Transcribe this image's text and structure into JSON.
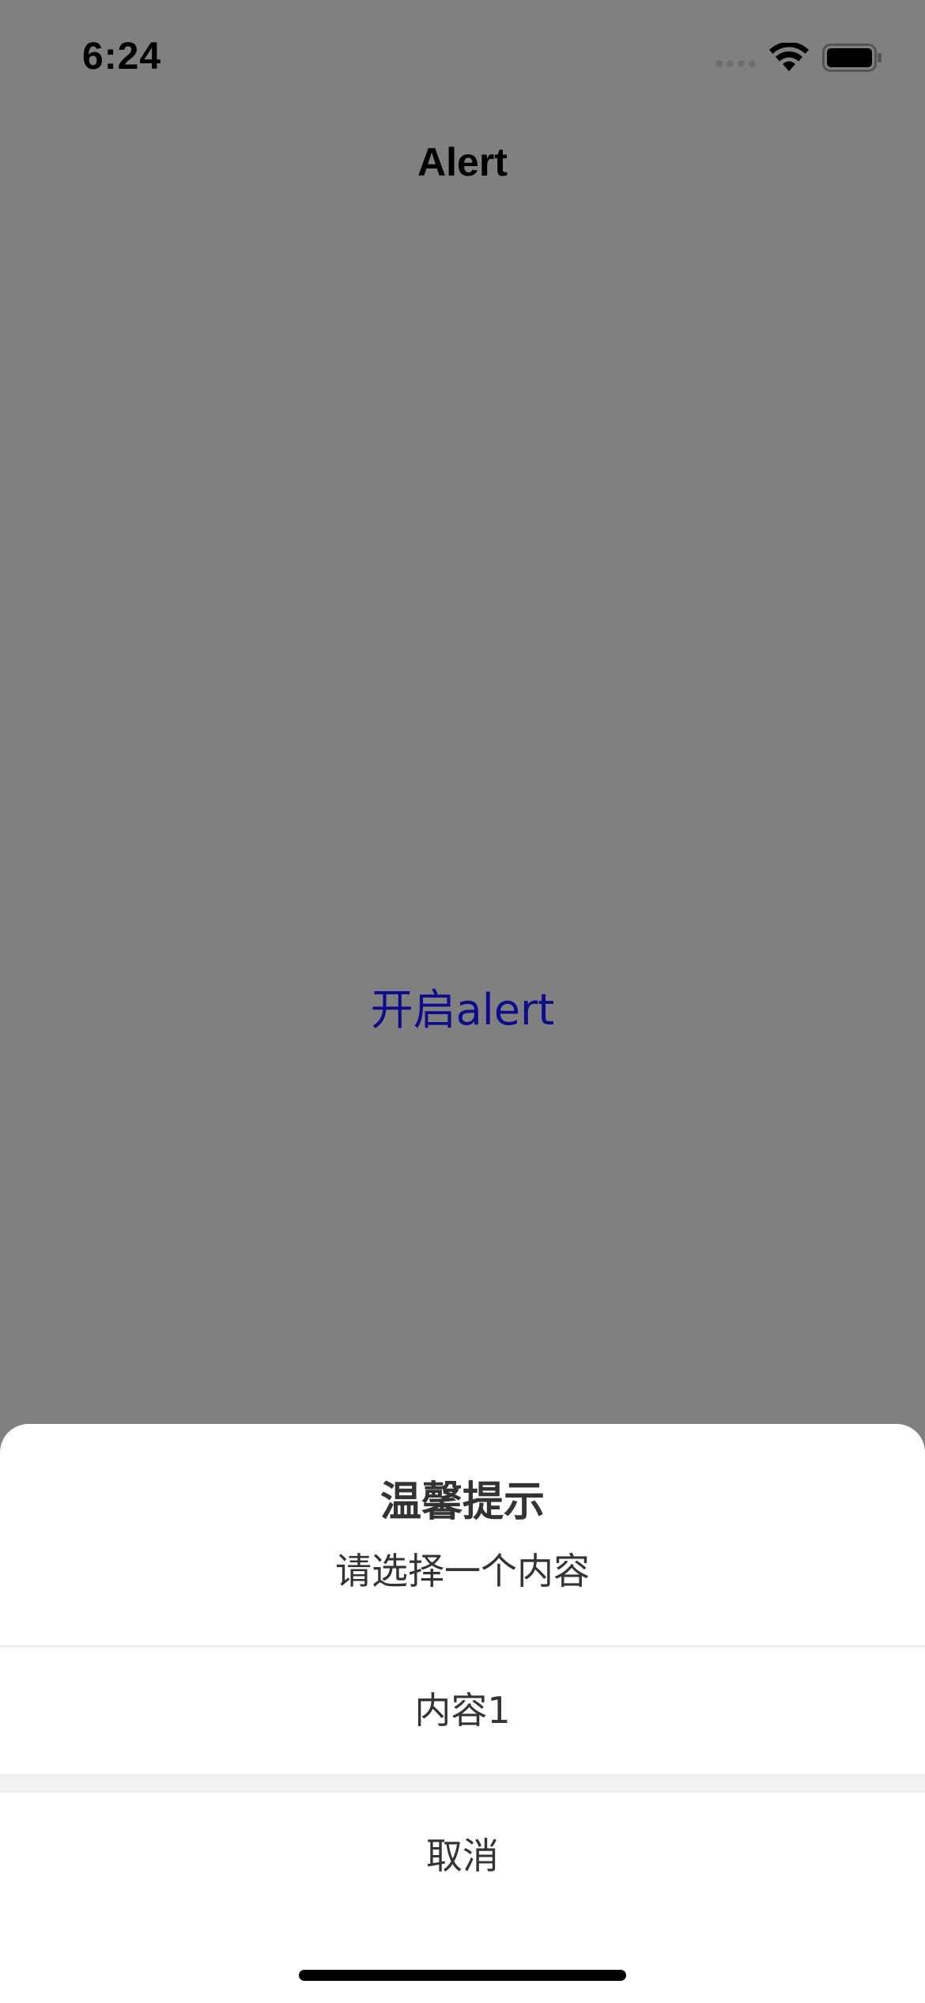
{
  "status_bar": {
    "time": "6:24",
    "signal_icon": "cellular-signal-icon",
    "wifi_icon": "wifi-icon",
    "battery_icon": "battery-icon"
  },
  "nav": {
    "title": "Alert"
  },
  "main": {
    "open_alert_label": "开启alert",
    "link_color": "#0d0d8c"
  },
  "action_sheet": {
    "title": "温馨提示",
    "message": "请选择一个内容",
    "options": [
      "内容1"
    ],
    "cancel_label": "取消"
  },
  "colors": {
    "background_dim": "#808080",
    "sheet_background": "#ffffff",
    "text_dark": "#333333"
  }
}
